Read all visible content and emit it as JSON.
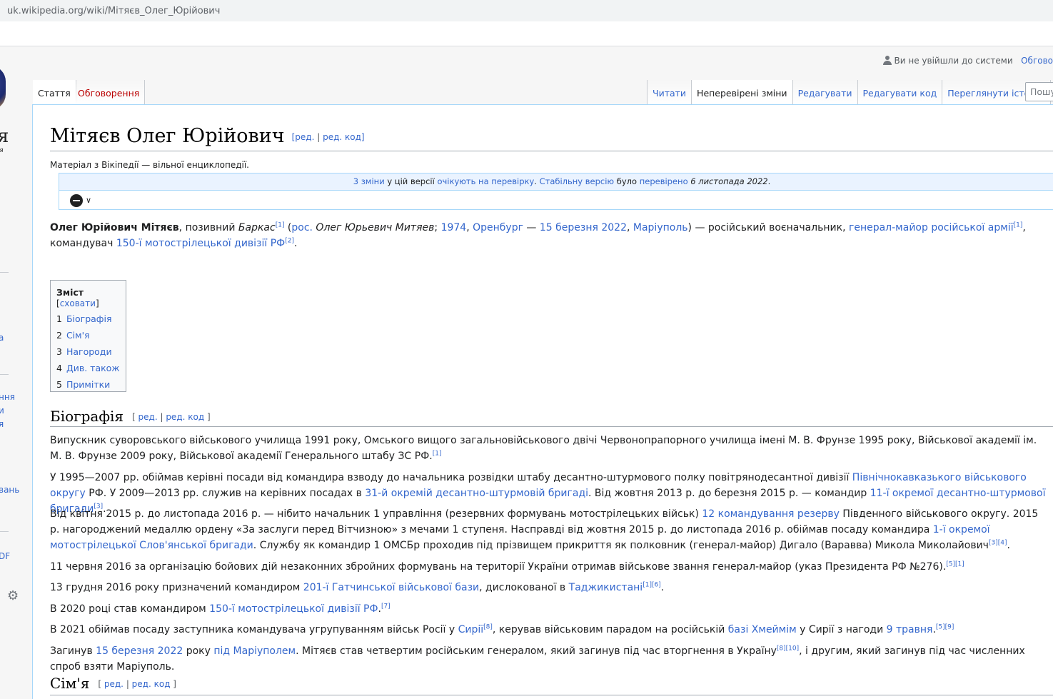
{
  "browser": {
    "url": "uk.wikipedia.org/wiki/Мітяєв_Олег_Юрійович"
  },
  "sidebar": {
    "logo_letter": "я",
    "logo_sub": "ія",
    "fragments": [
      "а",
      "ння",
      "и",
      "я",
      "вань",
      "DF"
    ]
  },
  "personal": {
    "not_logged_in": "Ви не увійшли до системи",
    "talk": "Обгово"
  },
  "tabs": {
    "article": "Стаття",
    "talk": "Обговорення",
    "read": "Читати",
    "pending_changes": "Неперевірені зміни",
    "edit": "Редагувати",
    "edit_source": "Редагувати код",
    "history": "Переглянути історію"
  },
  "search": {
    "placeholder": "Пошук"
  },
  "page": {
    "title": "Мітяєв Олег Юрійович",
    "edit_links": {
      "open": "[",
      "edit": "ред.",
      "sep": " | ",
      "edit_source": "ред. код",
      "close": "]"
    },
    "site_sub": "Матеріал з Вікіпедії — вільної енциклопедії.",
    "pending": {
      "link1": "3 зміни",
      "text1": " у цій версії ",
      "link2": "очікують на перевірку",
      "text2": ". ",
      "link3": "Стабільну версію",
      "text3": " було ",
      "link4": "перевірено",
      "text4": " ",
      "date": "6 листопада 2022",
      "end": "."
    }
  },
  "lead": {
    "name": "Олег Юрійович Мітяєв",
    "t1": ", позивний ",
    "callsign": "Баркас",
    "r1": "[1]",
    "t2": " (",
    "rus_link": "рос.",
    "rus_name": " Олег Юрьевич Митяев",
    "t3": "; ",
    "year": "1974",
    "t4": ", ",
    "orenburg": "Оренбург",
    "t5": " — ",
    "death_date": "15 березня 2022",
    "t6": ", ",
    "mariupol": "Маріуполь",
    "t7": ") — російський воєначальник, ",
    "rank": "генерал-майор російської армії",
    "r2": "[1]",
    "t8": ", командувач ",
    "division": "150-ї мотострілецької дивізії РФ",
    "r3": "[2]",
    "t9": "."
  },
  "toc": {
    "title": "Зміст",
    "toggle": "сховати",
    "items": [
      {
        "num": "1",
        "label": "Біографія"
      },
      {
        "num": "2",
        "label": "Сім'я"
      },
      {
        "num": "3",
        "label": "Нагороди"
      },
      {
        "num": "4",
        "label": "Див. також"
      },
      {
        "num": "5",
        "label": "Примітки"
      }
    ]
  },
  "sections": {
    "bio": "Біографія",
    "family": "Сім'я",
    "edit_links": {
      "open": "[ ",
      "edit": "ред.",
      "sep": " | ",
      "edit_source": "ред. код",
      "close": " ]"
    }
  },
  "bio": {
    "p1": {
      "t1": "Випускник суворовського військового училища 1991 року, Омського вищого загальновійськового двічі Червонопрапорного училища імені М. В. Фрунзе 1995 року, Військової академії ім. М. В. Фрунзе 2009 року, Військової академії Генерального штабу ЗС РФ.",
      "r1": "[1]"
    },
    "p2": {
      "t1": "У 1995—2007 рр. обіймав керівні посади від командира взводу до начальника розвідки штабу десантно-штурмового полку повітрянодесантної дивізії ",
      "l1": "Північнокавказького військового округу",
      "t2": " РФ. У 2009—2013 рр. служив на керівних посадах в ",
      "l2": "31-й окремій десантно-штурмовій бригаді",
      "t3": ". Від жовтня 2013 р. до березня 2015 р. — командир ",
      "l3": "11-ї окремої десантно-штурмової бригади",
      "r1": "[3]",
      "t4": "."
    },
    "p3": {
      "t1": "Від квітня 2015 р. до листопада 2016 р. — нібито начальник 1 управління (резервних формувань мотострілецьких військ) ",
      "l1": "12 командування резерву",
      "t2": " Південного військового округу. 2015 р. нагороджений медаллю ордену «За заслуги перед Вітчизною» з мечами 1 ступеня. Насправді від жовтня 2015 р. до листопада 2016 р. обіймав посаду командира ",
      "l2": "1-ї окремої мотострілецької Слов'янської бригади",
      "t3": ". Службу як командир 1 ОМСБр проходив під прізвищем прикриття як полковник (генерал-майор) Дигало (Варавва) Микола Миколайович",
      "r1": "[3][4]",
      "t4": "."
    },
    "p4": {
      "t1": "11 червня 2016 за організацію бойових дій незаконних збройних формувань на території України отримав військове звання генерал-майор (указ Президента РФ №276).",
      "r1": "[5][1]"
    },
    "p5": {
      "t1": "13 грудня 2016 року призначений командиром ",
      "l1": "201-ї Гатчинської військової бази",
      "t2": ", дислокованої в ",
      "l2": "Таджикистані",
      "r1": "[1][6]",
      "t3": "."
    },
    "p6": {
      "t1": "В 2020 році став командиром ",
      "l1": "150-ї мотострілецької дивізії РФ",
      "t2": ".",
      "r1": "[7]"
    },
    "p7": {
      "t1": "В 2021 обіймав посаду заступника командувача угрупуванням військ Росії у ",
      "l1": "Сирії",
      "r1": "[8]",
      "t2": ", керував військовим парадом на російській ",
      "l2": "базі Хмеймім",
      "t3": " у Сирії з нагоди ",
      "l3": "9 травня",
      "t4": ".",
      "r2": "[5][9]"
    },
    "p8": {
      "t1": "Загинув ",
      "l1": "15 березня 2022",
      "t2": " року ",
      "l2": "під Маріуполем",
      "t3": ". Мітяєв став четвертим російським генералом, який загинув під час вторгнення в Україну",
      "r1": "[8][10]",
      "t4": ", і другим, який загинув під час численних спроб взяти Маріуполь."
    }
  },
  "colors": {
    "link": "#3366cc",
    "redlink": "#ba0000",
    "border": "#a2a9b1",
    "pending_bg": "#eaf3ff"
  },
  "icons": [
    "user-icon",
    "review-status-icon",
    "chevron-down-icon",
    "gear-icon"
  ]
}
